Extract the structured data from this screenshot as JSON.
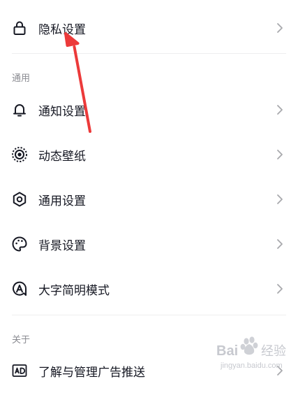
{
  "colors": {
    "text": "#161823",
    "secondary_text": "#8a8b91",
    "chevron": "#a8a9ad",
    "divider": "#eeeeef",
    "arrow": "#ec3a3a"
  },
  "rows": {
    "privacy": {
      "label": "隐私设置",
      "icon": "lock-icon"
    },
    "notification": {
      "label": "通知设置",
      "icon": "bell-icon"
    },
    "live_wallpaper": {
      "label": "动态壁纸",
      "icon": "live-wallpaper-icon"
    },
    "general": {
      "label": "通用设置",
      "icon": "gear-icon"
    },
    "background": {
      "label": "背景设置",
      "icon": "palette-icon"
    },
    "large_text": {
      "label": "大字简明模式",
      "icon": "large-text-icon"
    },
    "ads": {
      "label": "了解与管理广告推送",
      "icon": "ad-icon"
    }
  },
  "sections": {
    "general_title": "通用",
    "about_title": "关于"
  },
  "watermark": {
    "brand": "Bai",
    "brand2": "经验",
    "url": "jingyan.baidu.com"
  }
}
